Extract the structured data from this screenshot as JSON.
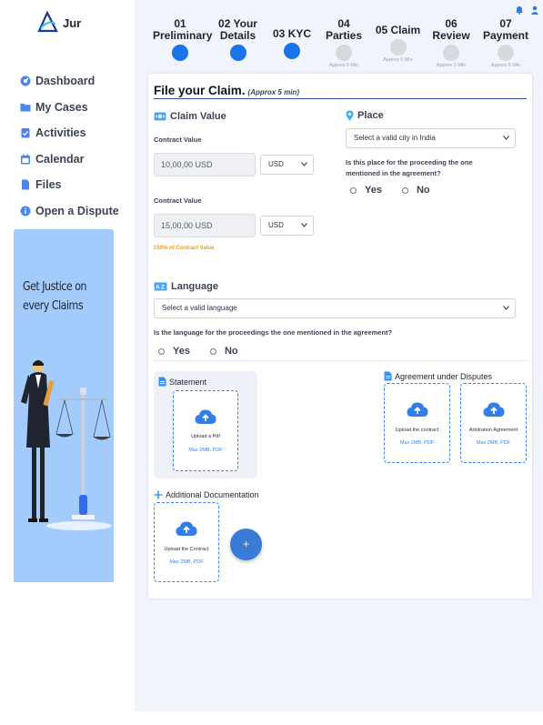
{
  "app": {
    "logo_text": "Jur"
  },
  "sidebar": {
    "items": [
      {
        "label": "Dashboard",
        "icon": "dashboard-icon"
      },
      {
        "label": "My Cases",
        "icon": "folder-icon"
      },
      {
        "label": "Activities",
        "icon": "clipboard-check-icon"
      },
      {
        "label": "Calendar",
        "icon": "calendar-icon"
      },
      {
        "label": "Files",
        "icon": "file-icon"
      },
      {
        "label": "Open a Dispute",
        "icon": "info-icon"
      }
    ],
    "promo_text": "Get Justice on every Claims"
  },
  "header": {
    "icons": [
      "bell-icon",
      "user-icon"
    ]
  },
  "steps": [
    {
      "number": "01",
      "name": "Preliminary",
      "note": "",
      "state": "done"
    },
    {
      "number": "02 Your",
      "name": "Details",
      "note": "",
      "state": "done"
    },
    {
      "number": "03 KYC",
      "name": "",
      "note": "",
      "state": "current"
    },
    {
      "number": "04",
      "name": "Parties",
      "note": "Approx 5 Min",
      "state": "pending"
    },
    {
      "number": "05 Claim",
      "name": "",
      "note": "Approx 5 Min",
      "state": "pending"
    },
    {
      "number": "06",
      "name": "Review",
      "note": "Approx 5 Min",
      "state": "pending"
    },
    {
      "number": "07",
      "name": "Payment",
      "note": "Approx 5 Min",
      "state": "pending"
    }
  ],
  "form": {
    "title": "File your Claim.",
    "title_note": "(Approx 5 min)",
    "claim_value": {
      "heading": "Claim Value",
      "contract_label_1": "Contract Value",
      "contract_value_1": "10,00,00 USD",
      "currency_1": "USD",
      "contract_label_2": "Contract Value",
      "contract_value_2": "15,00,00 USD",
      "currency_2": "USD",
      "warning": "150% of Contract Value"
    },
    "place": {
      "heading": "Place",
      "select_placeholder": "Select a valid city in India",
      "question": "Is this place for the proceeding the one mentioned in the agreement?",
      "yes": "Yes",
      "no": "No"
    },
    "language": {
      "heading": "Language",
      "select_placeholder": "Select a valid language",
      "question": "Is the language for the proceedings the one mentioned in the agreement?",
      "yes": "Yes",
      "no": "No"
    },
    "statement": {
      "heading": "Statement",
      "upload_title": "Upload a Pdf",
      "upload_note": "Max 2MB, PDF"
    },
    "agreement": {
      "heading": "Agreement under Disputes",
      "upload_1_title": "Upload the contract",
      "upload_1_note": "Max 2MB, PDF",
      "upload_2_title": "Arbitration Agreement",
      "upload_2_note": "Max 2MB, PDF"
    },
    "additional": {
      "heading": "Additional Documentation",
      "upload_title": "Upload the Contract",
      "upload_note": "Max 2MB, PDF",
      "add_label": "+"
    }
  },
  "colors": {
    "primary": "#1a73e8",
    "accent": "#3b82f6",
    "warning": "#f09a1a",
    "background": "#f2f4fb"
  }
}
